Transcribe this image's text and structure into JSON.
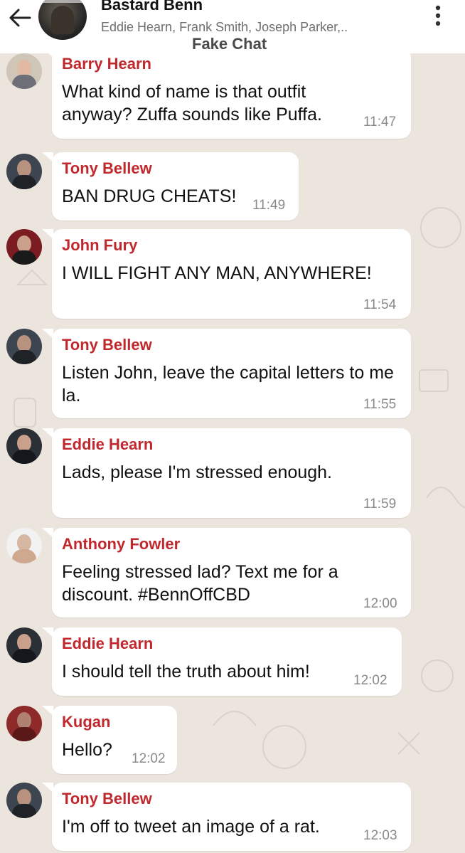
{
  "header": {
    "title": "Bastard Benn",
    "members": "Eddie Hearn, Frank Smith, Joseph Parker,..",
    "app_label": "Fake Chat"
  },
  "colors": {
    "background": "#ece5dd",
    "bubble": "#ffffff",
    "sender": "#c0282d",
    "time": "#8a8a8a"
  },
  "messages": [
    {
      "sender": "Barry Hearn",
      "text": "What kind of name is that outfit anyway? Zuffa sounds like Puffa.",
      "time": "11:47"
    },
    {
      "sender": "Tony Bellew",
      "text": "BAN DRUG CHEATS!",
      "time": "11:49"
    },
    {
      "sender": "John Fury",
      "text": "I WILL FIGHT ANY MAN, ANYWHERE!",
      "time": "11:54"
    },
    {
      "sender": "Tony Bellew",
      "text": "Listen John, leave the capital letters to me la.",
      "time": "11:55"
    },
    {
      "sender": "Eddie Hearn",
      "text": "Lads, please I'm stressed enough.",
      "time": "11:59"
    },
    {
      "sender": "Anthony Fowler",
      "text": "Feeling stressed lad? Text me for a discount. #BennOffCBD",
      "time": "12:00"
    },
    {
      "sender": "Eddie Hearn",
      "text": "I should tell the truth about him!",
      "time": "12:02"
    },
    {
      "sender": "Kugan",
      "text": "Hello?",
      "time": "12:02"
    },
    {
      "sender": "Tony Bellew",
      "text": "I'm off to tweet an image of a rat.",
      "time": "12:03"
    }
  ]
}
